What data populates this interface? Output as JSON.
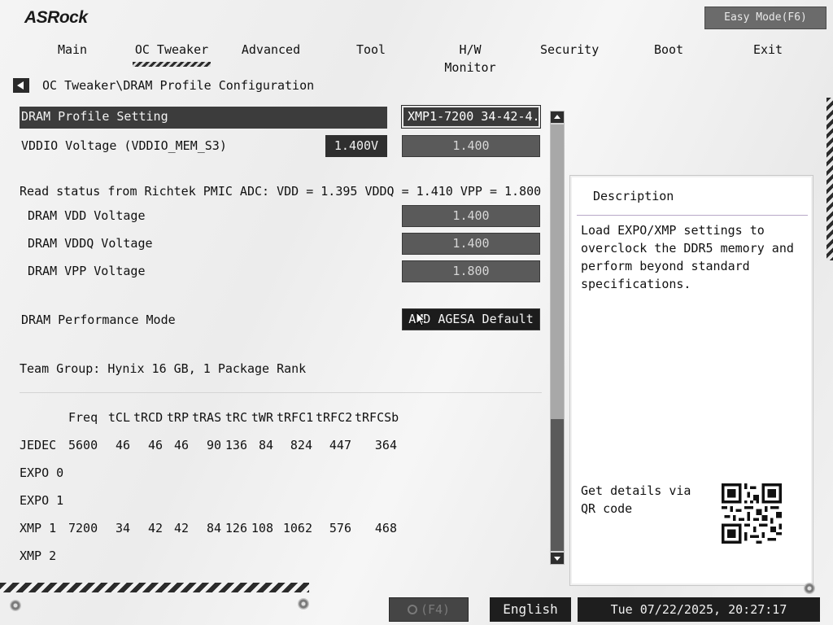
{
  "brand": {
    "logo": "ASRock"
  },
  "header": {
    "easy_mode": "Easy Mode(F6)"
  },
  "nav": {
    "tabs": [
      {
        "label": "Main"
      },
      {
        "label": "OC Tweaker"
      },
      {
        "label": "Advanced"
      },
      {
        "label": "Tool"
      },
      {
        "label": "H/W Monitor"
      },
      {
        "label": "Security"
      },
      {
        "label": "Boot"
      },
      {
        "label": "Exit"
      }
    ],
    "active": "OC Tweaker"
  },
  "breadcrumb": "OC Tweaker\\DRAM Profile Configuration",
  "settings": {
    "profile": {
      "label": "DRAM Profile Setting",
      "value": "XMP1-7200 34-42-4..."
    },
    "vddio": {
      "label": "VDDIO Voltage (VDDIO_MEM_S3)",
      "current": "1.400V",
      "value": "1.400"
    },
    "pmic_status": "Read status from Richtek PMIC ADC: VDD = 1.395 VDDQ = 1.410 VPP = 1.800",
    "vdd": {
      "label": "DRAM VDD Voltage",
      "value": "1.400"
    },
    "vddq": {
      "label": "DRAM VDDQ Voltage",
      "value": "1.400"
    },
    "vpp": {
      "label": "DRAM VPP Voltage",
      "value": "1.800"
    },
    "perf_mode": {
      "label": "DRAM Performance Mode",
      "value": "AMD AGESA Default"
    },
    "module_info": "Team Group: Hynix 16 GB, 1 Package Rank"
  },
  "timing_table": {
    "headers": [
      "Freq",
      "tCL",
      "tRCD",
      "tRP",
      "tRAS",
      "tRC",
      "tWR",
      "tRFC1",
      "tRFC2",
      "tRFCSb"
    ],
    "rows": [
      {
        "name": "JEDEC",
        "values": [
          "5600",
          "46",
          "46",
          "46",
          "90",
          "136",
          "84",
          "824",
          "447",
          "364"
        ]
      },
      {
        "name": "EXPO 0",
        "values": []
      },
      {
        "name": "EXPO 1",
        "values": []
      },
      {
        "name": "XMP 1",
        "values": [
          "7200",
          "34",
          "42",
          "42",
          "84",
          "126",
          "108",
          "1062",
          "576",
          "468"
        ]
      },
      {
        "name": "XMP 2",
        "values": []
      }
    ]
  },
  "description": {
    "title": "Description",
    "text": "Load EXPO/XMP settings to overclock the DDR5 memory and perform beyond standard specifications.",
    "qr_label": "Get details via QR code"
  },
  "footer": {
    "search": "(F4)",
    "language": "English",
    "datetime": "Tue 07/22/2025, 20:27:17"
  },
  "colors": {
    "accent_dark": "#3c3c3c",
    "panel": "#ffffff",
    "value_box": "#5a5a5a"
  },
  "icons": {
    "back": "back-arrow-icon",
    "search": "search-icon",
    "qr": "qr-code-icon"
  }
}
